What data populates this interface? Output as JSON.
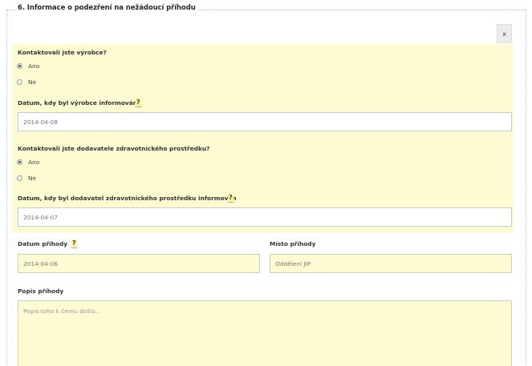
{
  "section": {
    "title": "6. Informace o podezření na nežádoucí příhodu",
    "close_label": "x"
  },
  "manufacturer": {
    "question": "Kontaktovali jste výrobce?",
    "options": [
      "Ano",
      "Ne"
    ],
    "selected": "Ano",
    "date_label": "Datum, kdy byl výrobce informován",
    "help": "?",
    "date_value": "2014-04-08"
  },
  "supplier": {
    "question": "Kontaktovali jste dodavatele zdravotnického prostředku?",
    "options": [
      "Ano",
      "Ne"
    ],
    "selected": "Ano",
    "date_label": "Datum, kdy byl dodavatel zdravotnického prostředku informován",
    "help": "?",
    "date_value": "2014-04-07"
  },
  "incident": {
    "date_label": "Datum příhody",
    "help": "?",
    "date_value": "2014-04-06",
    "place_label": "Místo příhody",
    "place_value": "Oddělení JIP",
    "description_label": "Popis příhody",
    "description_placeholder": "Popis toho k čemu došlo..."
  }
}
